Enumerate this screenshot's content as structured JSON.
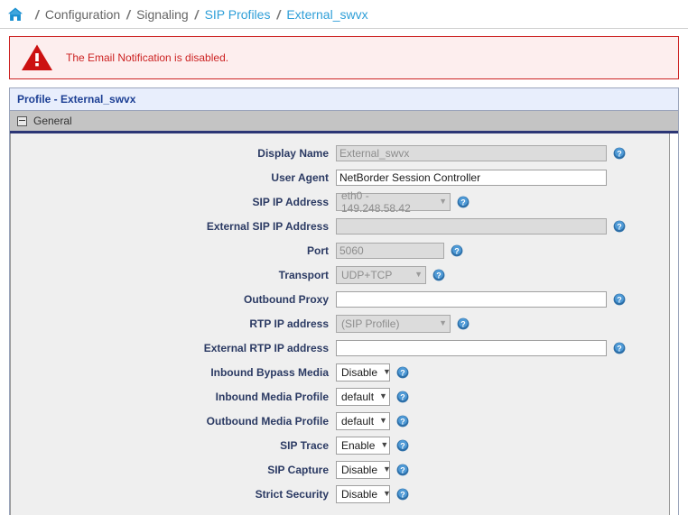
{
  "breadcrumb": {
    "home_icon": "home-icon",
    "separator": "/",
    "items": [
      {
        "label": "Configuration",
        "is_link": false
      },
      {
        "label": "Signaling",
        "is_link": false
      },
      {
        "label": "SIP Profiles",
        "is_link": true
      },
      {
        "label": "External_swvx",
        "is_link": true
      }
    ]
  },
  "alert": {
    "icon": "warning-triangle-icon",
    "message": "The Email Notification is disabled.",
    "color": "#cc2222"
  },
  "panel": {
    "title": "Profile - External_swvx",
    "section": {
      "label": "General",
      "toggle_icon": "collapse-minus-icon"
    }
  },
  "form": {
    "help_icon": "help-question-icon",
    "rows": [
      {
        "label": "Display Name",
        "control": "text",
        "value": "External_swvx",
        "disabled": true,
        "help": true,
        "width_class": "w-wide"
      },
      {
        "label": "User Agent",
        "control": "text",
        "value": "NetBorder Session Controller",
        "disabled": false,
        "help": false,
        "width_class": "w-wide"
      },
      {
        "label": "SIP IP Address",
        "control": "select",
        "value": "eth0 - 149.248.58.42",
        "disabled": true,
        "help": true,
        "width_class": "sel-ip"
      },
      {
        "label": "External SIP IP Address",
        "control": "text",
        "value": "",
        "disabled": true,
        "help": true,
        "width_class": "w-wide"
      },
      {
        "label": "Port",
        "control": "text",
        "value": "5060",
        "disabled": true,
        "help": true,
        "width_class": "w-port"
      },
      {
        "label": "Transport",
        "control": "select",
        "value": "UDP+TCP",
        "disabled": true,
        "help": true,
        "width_class": "sel-transport"
      },
      {
        "label": "Outbound Proxy",
        "control": "text",
        "value": "",
        "disabled": false,
        "help": true,
        "width_class": "w-wide"
      },
      {
        "label": "RTP IP address",
        "control": "select",
        "value": "(SIP Profile)",
        "disabled": true,
        "help": true,
        "width_class": "sel-rtp"
      },
      {
        "label": "External RTP IP address",
        "control": "text",
        "value": "",
        "disabled": false,
        "help": true,
        "width_class": "w-wide"
      },
      {
        "label": "Inbound Bypass Media",
        "control": "select",
        "value": "Disable",
        "disabled": false,
        "help": true,
        "width_class": "sel-small"
      },
      {
        "label": "Inbound Media Profile",
        "control": "select",
        "value": "default",
        "disabled": false,
        "help": true,
        "width_class": "sel-small"
      },
      {
        "label": "Outbound Media Profile",
        "control": "select",
        "value": "default",
        "disabled": false,
        "help": true,
        "width_class": "sel-small"
      },
      {
        "label": "SIP Trace",
        "control": "select",
        "value": "Enable",
        "disabled": false,
        "help": true,
        "width_class": "sel-small"
      },
      {
        "label": "SIP Capture",
        "control": "select",
        "value": "Disable",
        "disabled": false,
        "help": true,
        "width_class": "sel-small"
      },
      {
        "label": "Strict Security",
        "control": "select",
        "value": "Disable",
        "disabled": false,
        "help": true,
        "width_class": "sel-small"
      }
    ]
  }
}
